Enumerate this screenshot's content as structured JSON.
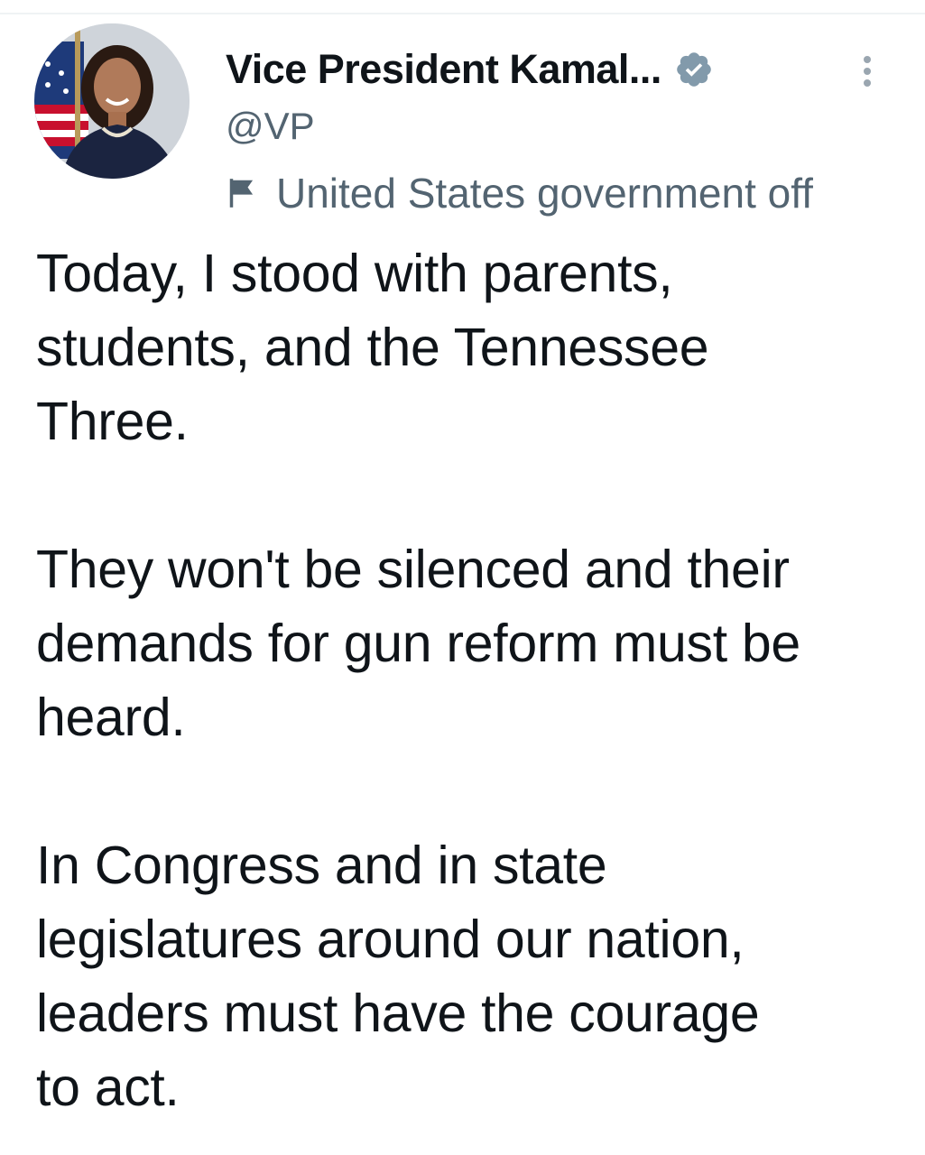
{
  "tweet": {
    "author": {
      "display_name": "Vice President Kamal...",
      "handle": "@VP",
      "verified_icon": "verified-badge-icon",
      "verified_color": "#829aab",
      "affiliation_label": "United States government off",
      "affiliation_icon": "flag-icon"
    },
    "menu_icon": "more-vertical-icon",
    "paragraphs": [
      "Today, I stood with parents,\nstudents, and the Tennessee\nThree.",
      "They won't be silenced and their\ndemands for gun reform must be\nheard.",
      "In Congress and in state\nlegislatures around our nation,\nleaders must have the courage\nto act."
    ]
  },
  "colors": {
    "text_primary": "#0f1419",
    "text_secondary": "#536471",
    "divider": "#eff3f4"
  }
}
